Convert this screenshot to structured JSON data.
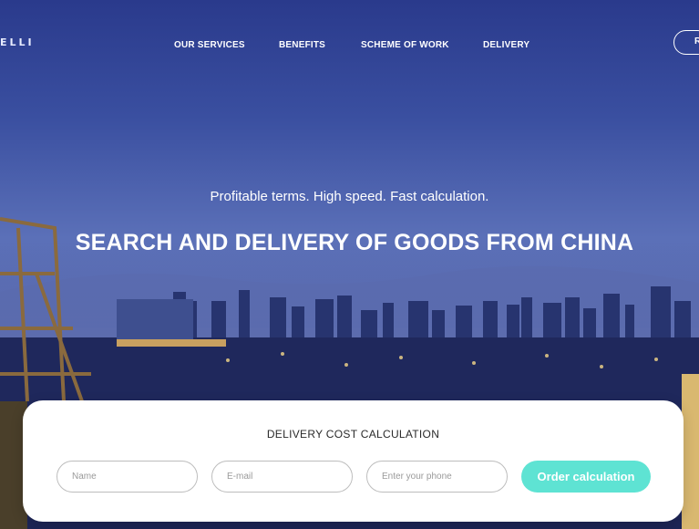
{
  "header": {
    "logo_text": "ELLI",
    "nav": [
      {
        "label": "OUR SERVICES"
      },
      {
        "label": "BENEFITS"
      },
      {
        "label": "SCHEME OF WORK"
      },
      {
        "label": "DELIVERY"
      }
    ],
    "cta_label": "R"
  },
  "hero": {
    "tagline": "Profitable terms. High speed. Fast calculation.",
    "headline": "SEARCH AND DELIVERY OF GOODS FROM CHINA"
  },
  "calc": {
    "title": "DELIVERY COST CALCULATION",
    "name_placeholder": "Name",
    "email_placeholder": "E-mail",
    "phone_placeholder": "Enter your phone",
    "submit_label": "Order calculation"
  },
  "colors": {
    "accent": "#5ee3d3",
    "hero_blue": "#3a4fa0",
    "card_bg": "#ffffff"
  }
}
